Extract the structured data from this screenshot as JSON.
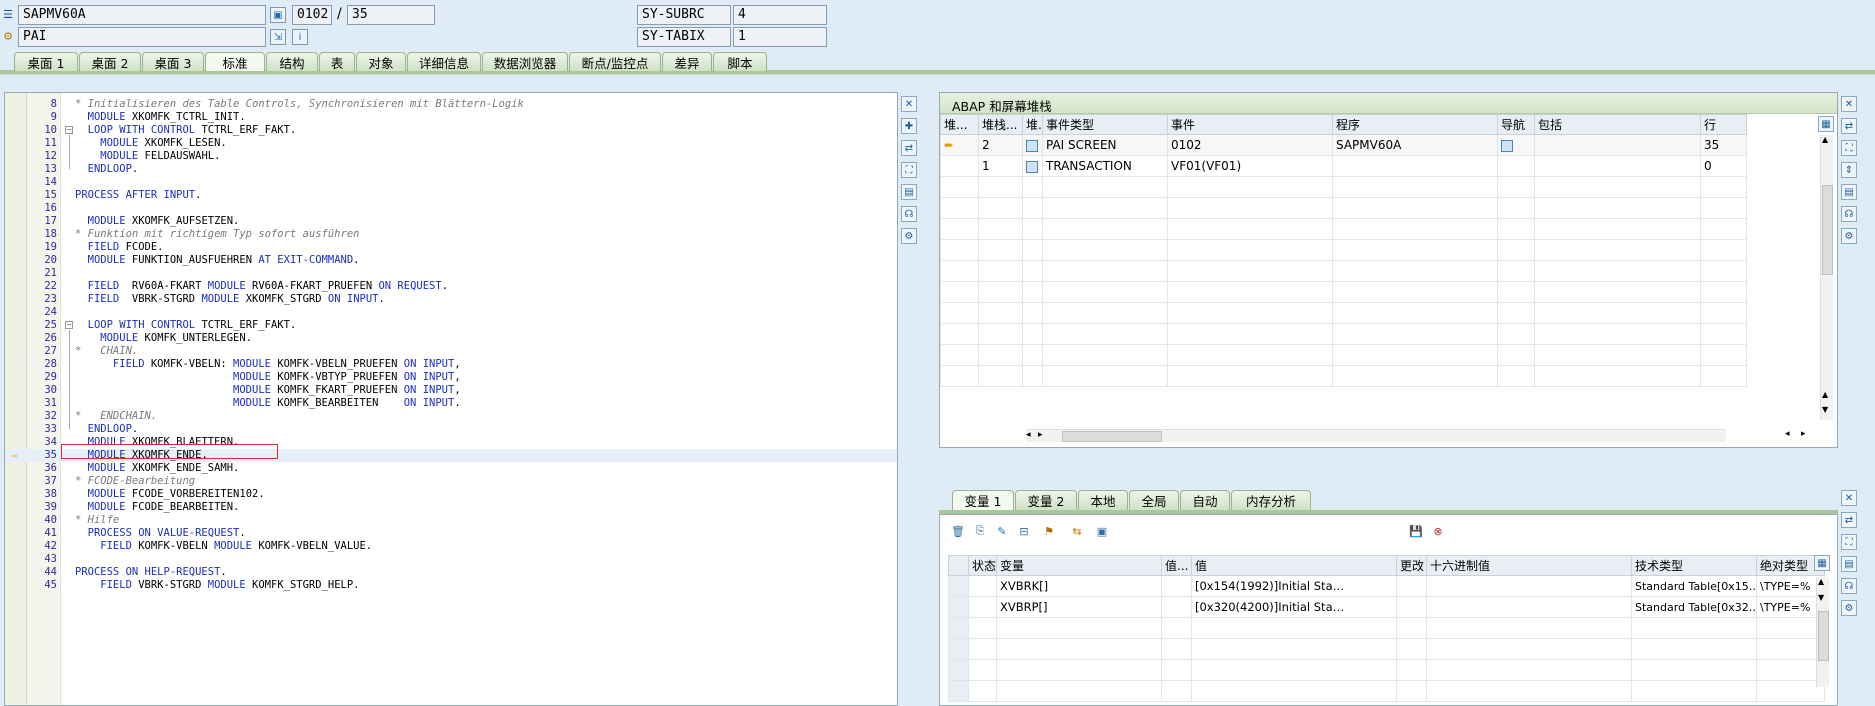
{
  "header": {
    "program": "SAPMV60A",
    "event": "PAI",
    "screen_number": "0102",
    "separator": "/",
    "line": "35",
    "sy_subrc_label": "SY-SUBRC",
    "sy_subrc_value": "4",
    "sy_tabix_label": "SY-TABIX",
    "sy_tabix_value": "1"
  },
  "tabs": [
    "桌面 1",
    "桌面 2",
    "桌面 3",
    "标准",
    "结构",
    "表",
    "对象",
    "详细信息",
    "数据浏览器",
    "断点/监控点",
    "差异",
    "脚本"
  ],
  "active_tab": "标准",
  "code": [
    {
      "n": "8",
      "parts": [
        [
          "cmt",
          "* Initialisieren des Table Controls, Synchronisieren mit Blättern-Logik"
        ]
      ]
    },
    {
      "n": "9",
      "parts": [
        [
          "kw",
          "  MODULE "
        ],
        [
          "tx",
          "XKOMFK_TCTRL_INIT."
        ]
      ]
    },
    {
      "n": "10",
      "fold": "−",
      "parts": [
        [
          "kw",
          "  LOOP WITH CONTROL "
        ],
        [
          "tx",
          "TCTRL_ERF_FAKT."
        ]
      ]
    },
    {
      "n": "11",
      "parts": [
        [
          "kw",
          "    MODULE "
        ],
        [
          "tx",
          "XKOMFK_LESEN."
        ]
      ]
    },
    {
      "n": "12",
      "parts": [
        [
          "kw",
          "    MODULE "
        ],
        [
          "tx",
          "FELDAUSWAHL."
        ]
      ]
    },
    {
      "n": "13",
      "parts": [
        [
          "kw",
          "  ENDLOOP"
        ],
        [
          "tx",
          "."
        ]
      ]
    },
    {
      "n": "14",
      "parts": []
    },
    {
      "n": "15",
      "parts": [
        [
          "kw",
          "PROCESS AFTER INPUT"
        ],
        [
          "tx",
          "."
        ]
      ]
    },
    {
      "n": "16",
      "parts": []
    },
    {
      "n": "17",
      "parts": [
        [
          "kw",
          "  MODULE "
        ],
        [
          "tx",
          "XKOMFK_AUFSETZEN."
        ]
      ]
    },
    {
      "n": "18",
      "parts": [
        [
          "cmt",
          "* Funktion mit richtigem Typ sofort ausführen"
        ]
      ]
    },
    {
      "n": "19",
      "parts": [
        [
          "kw",
          "  FIELD "
        ],
        [
          "tx",
          "FCODE."
        ]
      ]
    },
    {
      "n": "20",
      "parts": [
        [
          "kw",
          "  MODULE "
        ],
        [
          "tx",
          "FUNKTION_AUSFUEHREN "
        ],
        [
          "kw",
          "AT EXIT-COMMAND"
        ],
        [
          "tx",
          "."
        ]
      ]
    },
    {
      "n": "21",
      "parts": []
    },
    {
      "n": "22",
      "parts": [
        [
          "kw",
          "  FIELD  "
        ],
        [
          "tx",
          "RV60A-FKART "
        ],
        [
          "kw",
          "MODULE "
        ],
        [
          "tx",
          "RV60A-FKART_PRUEFEN "
        ],
        [
          "kw",
          "ON REQUEST"
        ],
        [
          "tx",
          "."
        ]
      ]
    },
    {
      "n": "23",
      "parts": [
        [
          "kw",
          "  FIELD  "
        ],
        [
          "tx",
          "VBRK-STGRD "
        ],
        [
          "kw",
          "MODULE "
        ],
        [
          "tx",
          "XKOMFK_STGRD "
        ],
        [
          "kw",
          "ON INPUT"
        ],
        [
          "tx",
          "."
        ]
      ]
    },
    {
      "n": "24",
      "parts": []
    },
    {
      "n": "25",
      "fold": "−",
      "parts": [
        [
          "kw",
          "  LOOP WITH CONTROL "
        ],
        [
          "tx",
          "TCTRL_ERF_FAKT."
        ]
      ]
    },
    {
      "n": "26",
      "parts": [
        [
          "kw",
          "    MODULE "
        ],
        [
          "tx",
          "KOMFK_UNTERLEGEN."
        ]
      ]
    },
    {
      "n": "27",
      "parts": [
        [
          "cmt",
          "*   CHAIN."
        ]
      ]
    },
    {
      "n": "28",
      "parts": [
        [
          "kw",
          "      FIELD "
        ],
        [
          "tx",
          "KOMFK-VBELN: "
        ],
        [
          "kw",
          "MODULE "
        ],
        [
          "tx",
          "KOMFK-VBELN_PRUEFEN "
        ],
        [
          "kw",
          "ON INPUT"
        ],
        [
          "tx",
          ","
        ]
      ]
    },
    {
      "n": "29",
      "parts": [
        [
          "kw",
          "                         MODULE "
        ],
        [
          "tx",
          "KOMFK-VBTYP_PRUEFEN "
        ],
        [
          "kw",
          "ON INPUT"
        ],
        [
          "tx",
          ","
        ]
      ]
    },
    {
      "n": "30",
      "parts": [
        [
          "kw",
          "                         MODULE "
        ],
        [
          "tx",
          "KOMFK_FKART_PRUEFEN "
        ],
        [
          "kw",
          "ON INPUT"
        ],
        [
          "tx",
          ","
        ]
      ]
    },
    {
      "n": "31",
      "parts": [
        [
          "kw",
          "                         MODULE "
        ],
        [
          "tx",
          "KOMFK_BEARBEITEN    "
        ],
        [
          "kw",
          "ON INPUT"
        ],
        [
          "tx",
          "."
        ]
      ]
    },
    {
      "n": "32",
      "parts": [
        [
          "cmt",
          "*   ENDCHAIN."
        ]
      ]
    },
    {
      "n": "33",
      "parts": [
        [
          "kw",
          "  ENDLOOP"
        ],
        [
          "tx",
          "."
        ]
      ]
    },
    {
      "n": "34",
      "parts": [
        [
          "kw",
          "  MODULE "
        ],
        [
          "tx",
          "XKOMFK_BLAETTERN."
        ]
      ]
    },
    {
      "n": "35",
      "current": true,
      "parts": [
        [
          "kw",
          "  MODULE "
        ],
        [
          "tx",
          "XKOMFK_ENDE."
        ]
      ]
    },
    {
      "n": "36",
      "parts": [
        [
          "kw",
          "  MODULE "
        ],
        [
          "tx",
          "XKOMFK_ENDE_SAMH."
        ]
      ]
    },
    {
      "n": "37",
      "parts": [
        [
          "cmt",
          "* FCODE-Bearbeitung"
        ]
      ]
    },
    {
      "n": "38",
      "parts": [
        [
          "kw",
          "  MODULE "
        ],
        [
          "tx",
          "FCODE_VORBEREITEN102."
        ]
      ]
    },
    {
      "n": "39",
      "parts": [
        [
          "kw",
          "  MODULE "
        ],
        [
          "tx",
          "FCODE_BEARBEITEN."
        ]
      ]
    },
    {
      "n": "40",
      "parts": [
        [
          "cmt",
          "* Hilfe"
        ]
      ]
    },
    {
      "n": "41",
      "parts": [
        [
          "kw",
          "  PROCESS ON VALUE-REQUEST"
        ],
        [
          "tx",
          "."
        ]
      ]
    },
    {
      "n": "42",
      "parts": [
        [
          "kw",
          "    FIELD "
        ],
        [
          "tx",
          "KOMFK-VBELN "
        ],
        [
          "kw",
          "MODULE "
        ],
        [
          "tx",
          "KOMFK-VBELN_VALUE."
        ]
      ]
    },
    {
      "n": "43",
      "parts": []
    },
    {
      "n": "44",
      "parts": [
        [
          "kw",
          "PROCESS ON HELP-REQUEST"
        ],
        [
          "tx",
          "."
        ]
      ]
    },
    {
      "n": "45",
      "parts": [
        [
          "kw",
          "    FIELD "
        ],
        [
          "tx",
          "VBRK-STGRD "
        ],
        [
          "kw",
          "MODULE "
        ],
        [
          "tx",
          "KOMFK_STGRD_HELP."
        ]
      ]
    }
  ],
  "stack": {
    "title": "ABAP 和屏幕堆栈",
    "columns": [
      "堆...",
      "堆栈...",
      "堆.",
      "事件类型",
      "事件",
      "程序",
      "导航",
      "包括",
      "行"
    ],
    "rows": [
      {
        "level": "2",
        "event_type": "PAI SCREEN",
        "event": "0102",
        "program": "SAPMV60A",
        "line": "35",
        "current": true
      },
      {
        "level": "1",
        "event_type": "TRANSACTION",
        "event": "VF01(VF01)",
        "program": "",
        "line": "0",
        "current": false
      }
    ]
  },
  "vars": {
    "tabs": [
      "变量 1",
      "变量 2",
      "本地",
      "全局",
      "自动",
      "内存分析"
    ],
    "active_tab": "变量 1",
    "columns": [
      "状态",
      "变量",
      "值...",
      "值",
      "更改",
      "十六进制值",
      "技术类型",
      "绝对类型"
    ],
    "rows": [
      {
        "variable": "XVBRK[]",
        "value": "[0x154(1992)]Initial Sta…",
        "tech_type": "Standard Table[0x15…",
        "abs_type": "\\TYPE=%"
      },
      {
        "variable": "XVBRP[]",
        "value": "[0x320(4200)]Initial Sta…",
        "tech_type": "Standard Table[0x32…",
        "abs_type": "\\TYPE=%"
      }
    ]
  }
}
